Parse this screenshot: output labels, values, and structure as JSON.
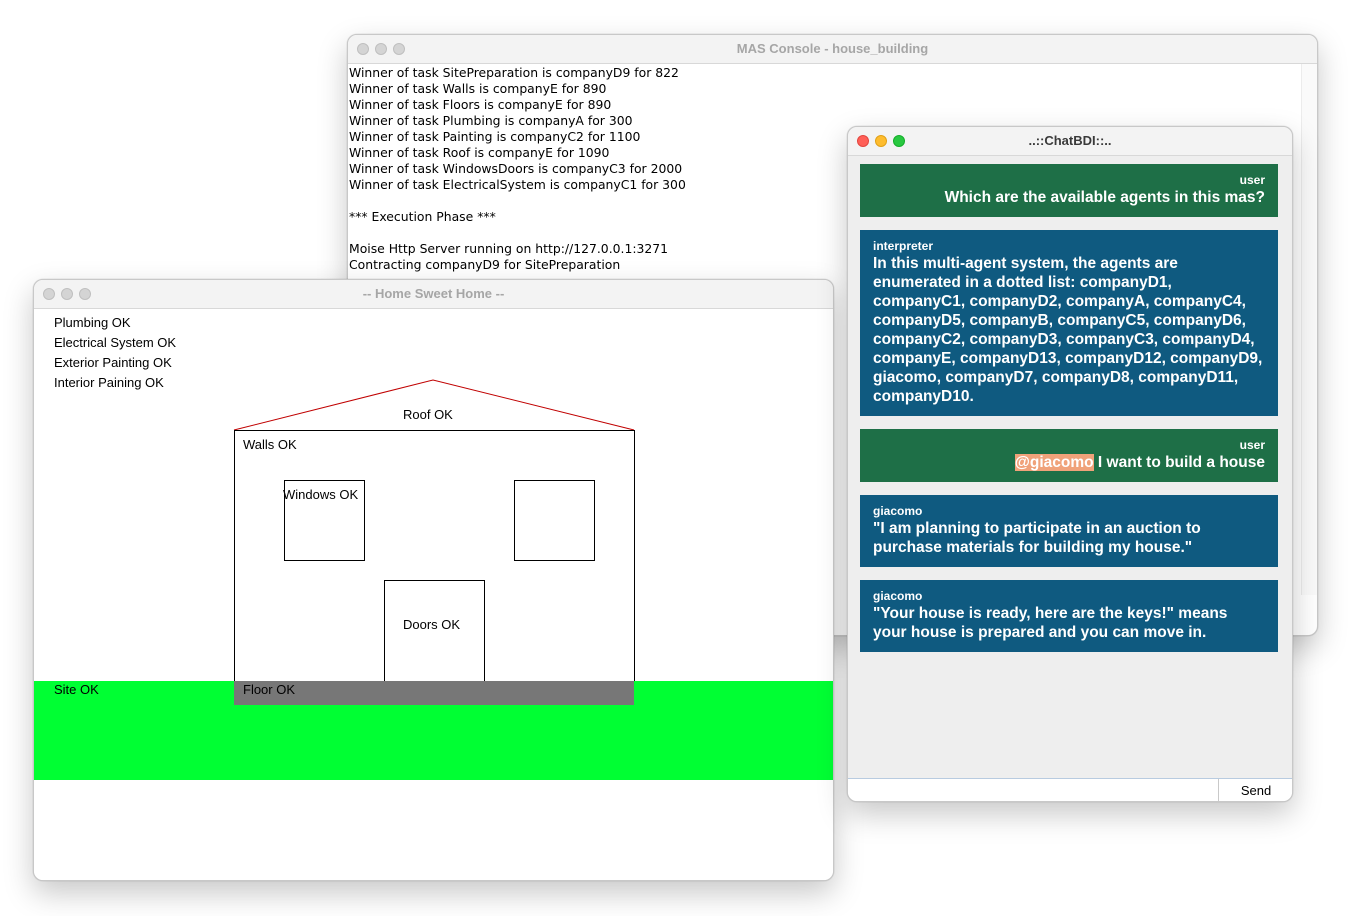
{
  "mas_console": {
    "title": "MAS Console - house_building",
    "log": [
      "Winner of task SitePreparation is companyD9 for 822",
      "Winner of task Walls is companyE for 890",
      "Winner of task Floors is companyE for 890",
      "Winner of task Plumbing is companyA for 300",
      "Winner of task Painting is companyC2 for 1100",
      "Winner of task Roof is companyE for 1090",
      "Winner of task WindowsDoors is companyC3 for 2000",
      "Winner of task ElectricalSystem is companyC1 for 300",
      "",
      "*** Execution Phase ***",
      "",
      "Moise Http Server running on http://127.0.0.1:3271",
      "Contracting companyD9 for SitePreparation"
    ]
  },
  "home_window": {
    "title": "-- Home Sweet Home --",
    "status": {
      "plumbing": "Plumbing OK",
      "electrical": "Electrical System OK",
      "exterior_painting": "Exterior Painting OK",
      "interior_painting": "Interior Paining OK"
    },
    "house": {
      "roof": "Roof OK",
      "walls": "Walls OK",
      "windows": "Windows OK",
      "doors": "Doors OK",
      "floor": "Floor OK",
      "site": "Site OK"
    },
    "colors": {
      "site": "#00ff33",
      "floor": "#777777",
      "roof_line": "#c00000"
    }
  },
  "chat_window": {
    "title": "..::ChatBDI::..",
    "messages": [
      {
        "role": "user",
        "sender": "user",
        "mention": "",
        "text": "Which are the available agents in this mas?"
      },
      {
        "role": "bot",
        "sender": "interpreter",
        "mention": "",
        "text": "In this multi-agent system, the agents are enumerated in a dotted list: companyD1, companyC1, companyD2, companyA, companyC4, companyD5, companyB, companyC5, companyD6, companyC2, companyD3, companyC3, companyD4, companyE, companyD13, companyD12, companyD9, giacomo, companyD7, companyD8, companyD11, companyD10."
      },
      {
        "role": "user",
        "sender": "user",
        "mention": "@giacomo",
        "text": " I want to build a house"
      },
      {
        "role": "bot",
        "sender": "giacomo",
        "mention": "",
        "text": "\"I am planning to participate in an auction to purchase materials for building my house.\""
      },
      {
        "role": "bot",
        "sender": "giacomo",
        "mention": "",
        "text": "\"Your house is ready, here are the keys!\" means your house is prepared and you can move in."
      }
    ],
    "input_value": "",
    "send_label": "Send",
    "colors": {
      "user_bubble": "#1e6f47",
      "bot_bubble": "#0f5a80",
      "mention": "#f0a27a"
    }
  }
}
